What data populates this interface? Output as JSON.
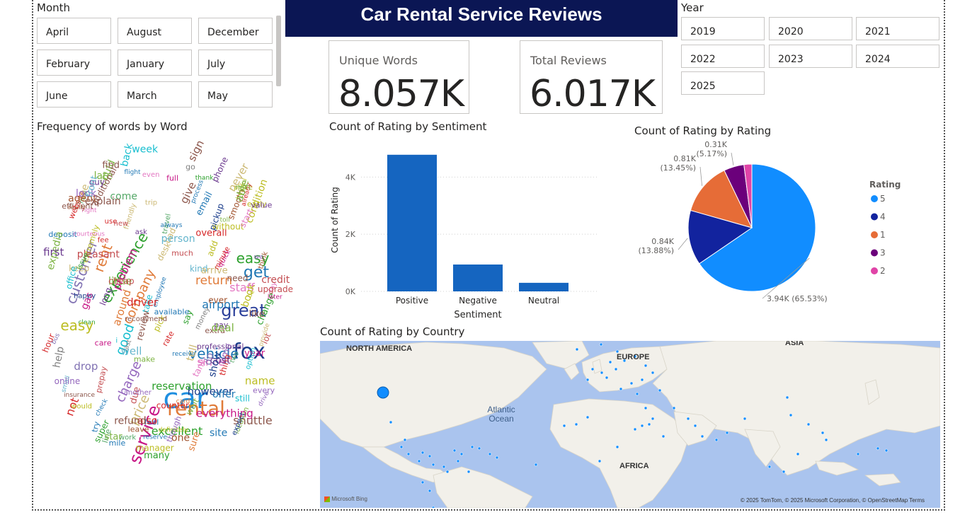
{
  "title": "Car Rental Service Reviews",
  "month_slicer": {
    "title": "Month",
    "options": [
      "April",
      "August",
      "December",
      "February",
      "January",
      "July",
      "June",
      "March",
      "May"
    ]
  },
  "year_slicer": {
    "title": "Year",
    "options": [
      "2019",
      "2020",
      "2021",
      "2022",
      "2023",
      "2024",
      "2025"
    ]
  },
  "cards": {
    "unique_words": {
      "label": "Unique Words",
      "value": "8.057K"
    },
    "total_reviews": {
      "label": "Total Reviews",
      "value": "6.017K"
    }
  },
  "word_cloud": {
    "title": "Frequency of words by Word",
    "words": [
      "car",
      "rental",
      "fox",
      "service",
      "great",
      "get",
      "easy",
      "rent",
      "customer",
      "experience",
      "company",
      "price",
      "charge",
      "vehicle",
      "good",
      "return",
      "staff",
      "airport",
      "pick",
      "shuttle",
      "not",
      "would",
      "time",
      "clean",
      "location",
      "recommend",
      "day",
      "quick",
      "book",
      "process",
      "make",
      "take",
      "use",
      "everything",
      "excellent",
      "professional",
      "friendly",
      "helpful",
      "upgrade",
      "insurance",
      "drop",
      "check",
      "counter",
      "deposit",
      "fee",
      "hour",
      "week",
      "work",
      "flight",
      "extremely",
      "definitely",
      "year",
      "manager",
      "however",
      "wait",
      "kind",
      "feel",
      "many",
      "right",
      "change",
      "prepay",
      "smooth",
      "efficient",
      "desk",
      "though",
      "really",
      "bad",
      "care",
      "drive",
      "extra",
      "come",
      "overall",
      "lot",
      "keep",
      "rate",
      "name",
      "even",
      "could",
      "say",
      "new",
      "receive",
      "employee",
      "little",
      "late",
      "pay",
      "go",
      "provide",
      "additional",
      "available",
      "website",
      "office",
      "option",
      "without",
      "place",
      "thing",
      "phone",
      "add",
      "small",
      "every",
      "leave",
      "due",
      "last",
      "travel",
      "line",
      "never",
      "sign",
      "nice",
      "long",
      "since",
      "tank",
      "deal",
      "explain",
      "problem",
      "expedia",
      "pleasant",
      "person",
      "cost",
      "early",
      "issue",
      "courteous",
      "email",
      "around",
      "driver",
      "always",
      "tell",
      "well",
      "arrive",
      "able",
      "find",
      "already",
      "still",
      "thank",
      "two",
      "cheap",
      "minute",
      "ask",
      "think",
      "try",
      "easy",
      "condition",
      "offer",
      "star",
      "value",
      "much",
      "see",
      "show",
      "review",
      "full",
      "need",
      "gas",
      "next",
      "guy",
      "mile",
      "i",
      "online",
      "money",
      "give",
      "trip",
      "later",
      "do",
      "we",
      "start",
      "expect",
      "happy",
      "sure",
      "bus",
      "ever",
      "agent",
      "another",
      "also",
      "back",
      "one",
      "toll",
      "reserve",
      "reservation",
      "super",
      "first",
      "help",
      "like",
      "credit",
      "look",
      "front",
      "refund",
      "site",
      "pickup",
      "be",
      "card"
    ]
  },
  "chart_data": [
    {
      "type": "bar",
      "title": "Count of Rating by Sentiment",
      "xlabel": "Sentiment",
      "ylabel": "Count of Rating",
      "categories": [
        "Positive",
        "Negative",
        "Neutral"
      ],
      "values": [
        4780,
        940,
        300
      ],
      "ylim": [
        0,
        4800
      ],
      "yticks": [
        0,
        2000,
        4000
      ],
      "ytick_labels": [
        "0K",
        "2K",
        "4K"
      ],
      "color": "#1565c0",
      "grid": true
    },
    {
      "type": "pie",
      "title": "Count of Rating by Rating",
      "legend_title": "Rating",
      "legend_position": "right",
      "slices": [
        {
          "label": "5",
          "value": 3940,
          "display": "3.94K (65.53%)",
          "color": "#118dff"
        },
        {
          "label": "4",
          "value": 840,
          "display": "0.84K (13.88%)",
          "color": "#12239e"
        },
        {
          "label": "1",
          "value": 810,
          "display": "0.81K (13.45%)",
          "color": "#e66c37"
        },
        {
          "label": "3",
          "value": 310,
          "display": "0.31K (5.17%)",
          "color": "#6b007b"
        },
        {
          "label": "2",
          "value": 120,
          "display": "",
          "color": "#e044a7"
        }
      ]
    }
  ],
  "map": {
    "title": "Count of Rating by Country",
    "labels": {
      "north_america": "NORTH AMERICA",
      "europe": "EUROPE",
      "asia": "ASIA",
      "africa": "AFRICA",
      "ocean": "Atlantic Ocean"
    },
    "attribution": "© 2025 TomTom, © 2025 Microsoft Corporation, © OpenStreetMap  Terms",
    "brand": "Microsoft Bing",
    "bubble_color": "#118dff"
  }
}
